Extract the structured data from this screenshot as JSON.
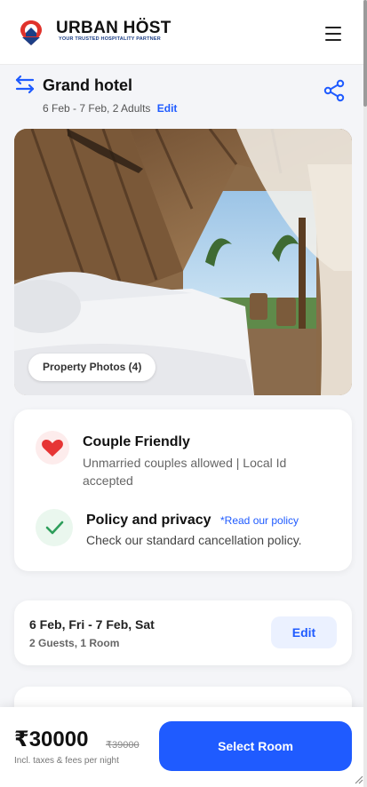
{
  "header": {
    "brand": "URBAN HÖST",
    "tagline": "YOUR TRUSTED HOSPITALITY PARTNER",
    "logo_icon": "location-pin-logo-icon",
    "menu_icon": "hamburger-menu-icon"
  },
  "booking": {
    "hotel_name": "Grand hotel",
    "dates_guests": "6 Feb - 7 Feb, 2 Adults",
    "edit_label": "Edit",
    "swap_icon": "swap-arrows-icon",
    "share_icon": "share-icon"
  },
  "photo": {
    "button_label": "Property Photos (4)"
  },
  "amenities": {
    "couple_title": "Couple Friendly",
    "couple_desc": "Unmarried couples allowed | Local Id accepted",
    "policy_title": "Policy and privacy",
    "policy_link": "*Read our policy",
    "policy_desc": "Check our standard cancellation policy."
  },
  "stay": {
    "dates": "6 Feb, Fri - 7 Feb, Sat",
    "guests_rooms": "2 Guests, 1 Room",
    "edit_label": "Edit"
  },
  "footer": {
    "price": "₹30000",
    "old_price": "₹39000",
    "note": "Incl. taxes & fees per night",
    "select_label": "Select Room"
  },
  "colors": {
    "accent": "#1f5bff",
    "heart": "#e63535",
    "check": "#2e9e5b"
  }
}
